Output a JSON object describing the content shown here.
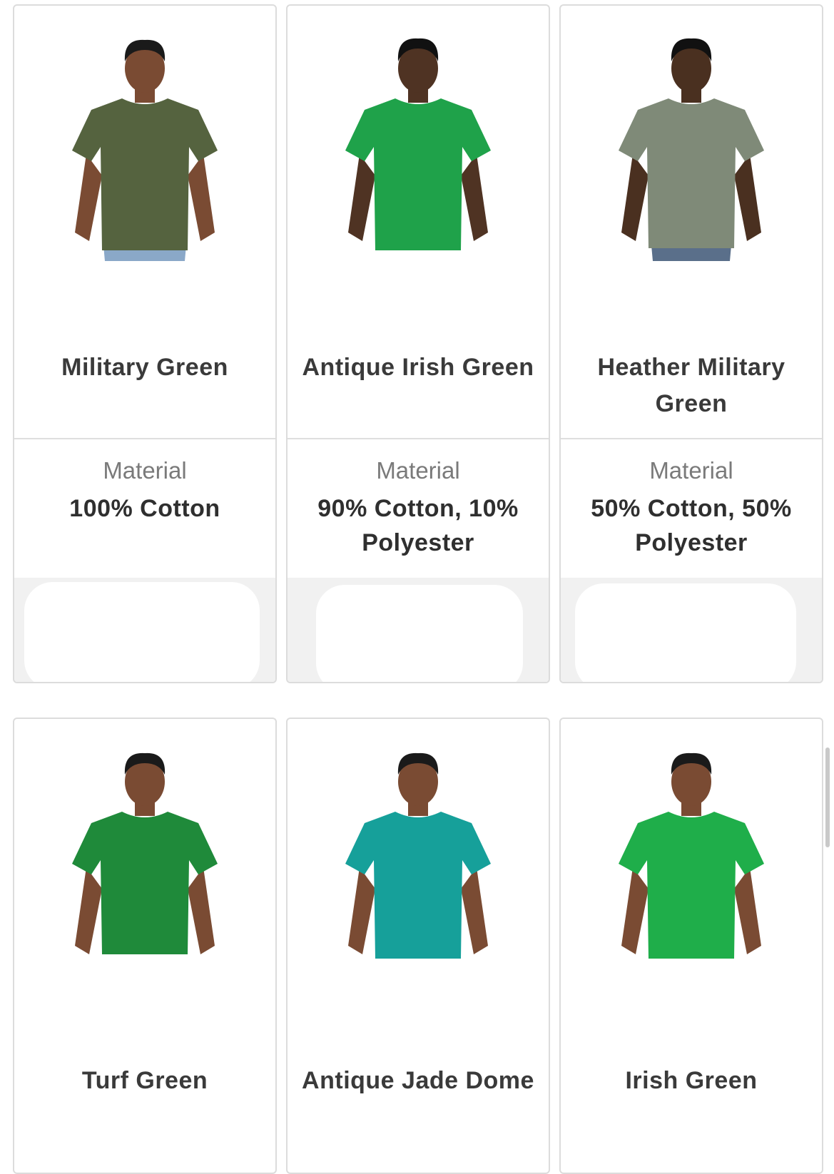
{
  "products": [
    {
      "name": "Military Green",
      "material_label": "Material",
      "material": "100% Cotton",
      "shirt_color": "#55633f",
      "skin": "#7a4b33"
    },
    {
      "name": "Antique Irish Green",
      "material_label": "Material",
      "material": "90% Cotton, 10% Polyester",
      "shirt_color": "#1fa24a",
      "skin": "#4f3323"
    },
    {
      "name": "Heather Military Green",
      "material_label": "Material",
      "material": "50% Cotton, 50% Polyester",
      "shirt_color": "#7f8a78",
      "skin": "#4a3020"
    },
    {
      "name": "Turf Green",
      "material_label": "",
      "material": "",
      "shirt_color": "#1f8a3a",
      "skin": "#7a4b33"
    },
    {
      "name": "Antique Jade Dome",
      "material_label": "",
      "material": "",
      "shirt_color": "#16a09a",
      "skin": "#7a4b33"
    },
    {
      "name": "Irish Green",
      "material_label": "",
      "material": "",
      "shirt_color": "#1fae4a",
      "skin": "#7a4b33"
    }
  ]
}
